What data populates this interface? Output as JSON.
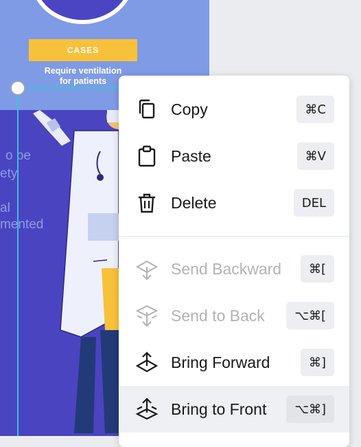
{
  "canvas": {
    "badge_label": "CASES",
    "caption_line1": "Require ventilation",
    "caption_line2": "for patients",
    "side_text": [
      "o be",
      "ety",
      "al",
      "mented"
    ]
  },
  "context_menu": {
    "items": [
      {
        "label": "Copy",
        "shortcut": "⌘C",
        "icon": "copy-icon",
        "enabled": true
      },
      {
        "label": "Paste",
        "shortcut": "⌘V",
        "icon": "paste-icon",
        "enabled": true
      },
      {
        "label": "Delete",
        "shortcut": "DEL",
        "icon": "trash-icon",
        "enabled": true
      },
      {
        "label": "Send Backward",
        "shortcut": "⌘[",
        "icon": "send-backward-icon",
        "enabled": false
      },
      {
        "label": "Send to Back",
        "shortcut": "⌥⌘[",
        "icon": "send-to-back-icon",
        "enabled": false
      },
      {
        "label": "Bring Forward",
        "shortcut": "⌘]",
        "icon": "bring-forward-icon",
        "enabled": true
      },
      {
        "label": "Bring to Front",
        "shortcut": "⌥⌘]",
        "icon": "bring-to-front-icon",
        "enabled": true,
        "highlighted": true
      }
    ]
  },
  "colors": {
    "top_panel": "#7f9be6",
    "bottom_panel": "#4a44c0",
    "badge": "#f8c13a",
    "selection": "#35c6d8",
    "disabled_text": "#b3b3b3"
  }
}
